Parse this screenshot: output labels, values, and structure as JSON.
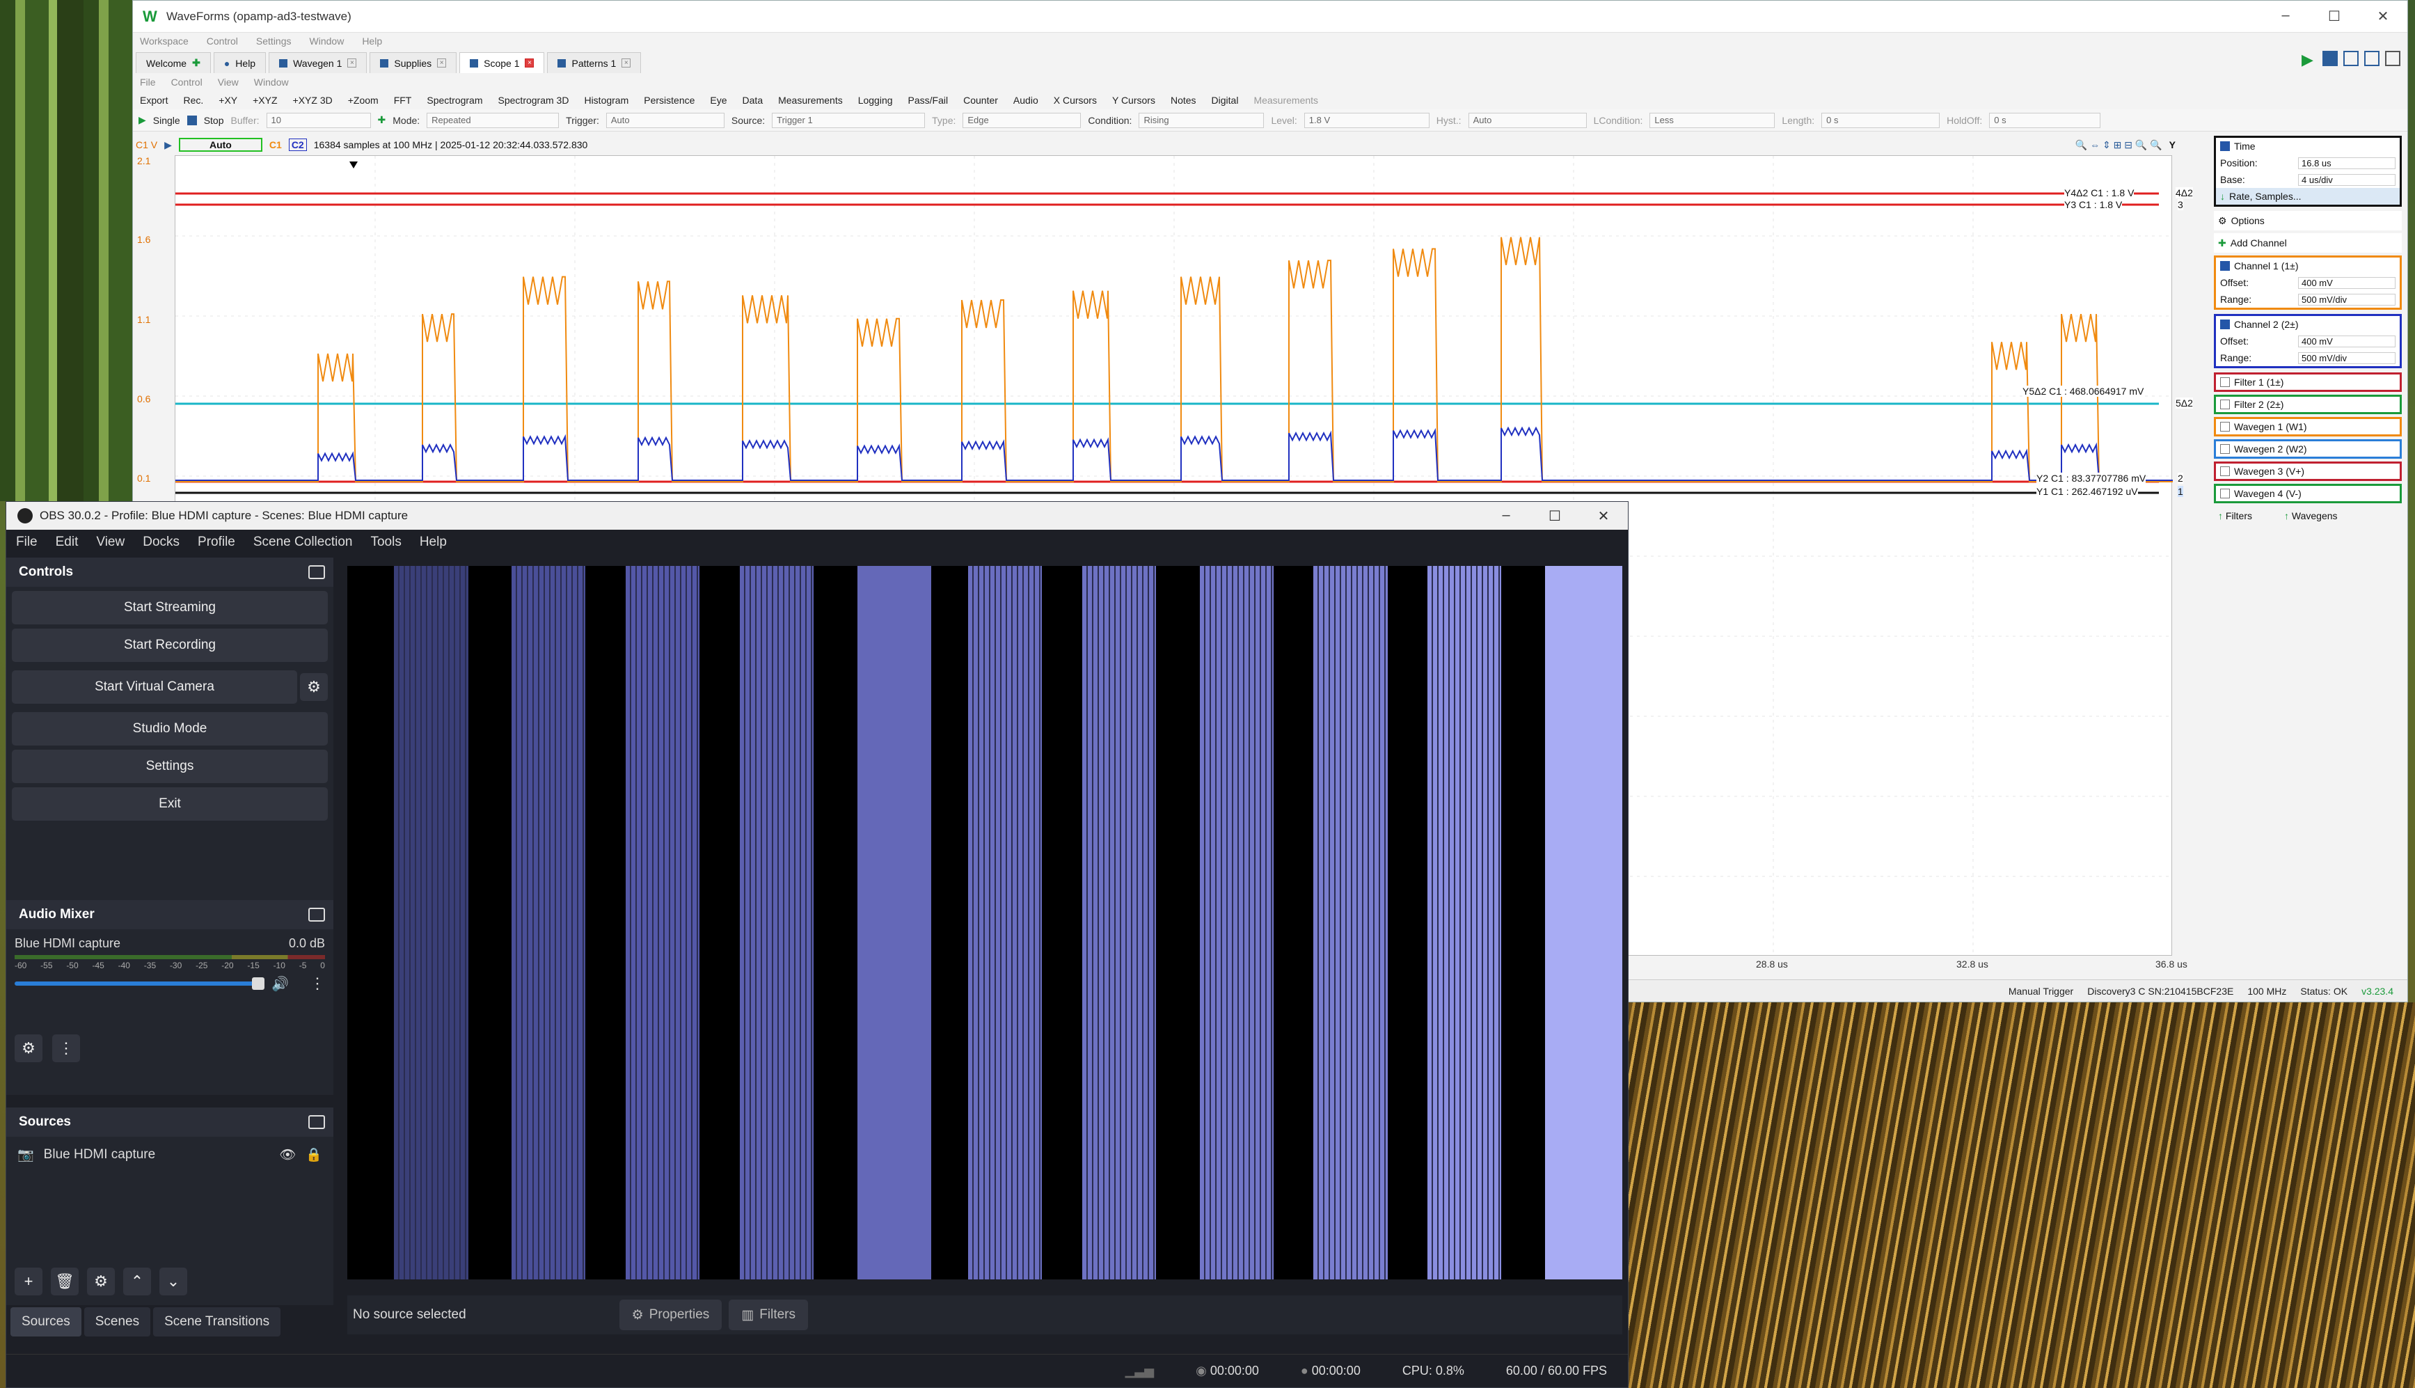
{
  "waveforms": {
    "title": "WaveForms (opamp-ad3-testwave)",
    "faint_menu": [
      "Workspace",
      "Control",
      "Settings",
      "Window",
      "Help"
    ],
    "tabs": [
      {
        "label": "Welcome",
        "close": "+"
      },
      {
        "label": "Help",
        "close": ""
      },
      {
        "label": "Wavegen 1",
        "close": "x"
      },
      {
        "label": "Supplies",
        "close": "x"
      },
      {
        "label": "Scope 1",
        "close": "x"
      },
      {
        "label": "Patterns 1",
        "close": "x"
      }
    ],
    "submenu": [
      "File",
      "Control",
      "View",
      "Window"
    ],
    "toolbar": [
      "Export",
      "Rec.",
      "+XY",
      "+XYZ",
      "+XYZ 3D",
      "+Zoom",
      "FFT",
      "Spectrogram",
      "Spectrogram 3D",
      "Histogram",
      "Persistence",
      "Eye",
      "Data",
      "Measurements",
      "Logging",
      "Pass/Fail",
      "Counter",
      "Audio",
      "X Cursors",
      "Y Cursors",
      "Notes",
      "Digital",
      "Measurements"
    ],
    "controls": {
      "single": "Single",
      "stop": "Stop",
      "buffer_label": "Buffer:",
      "buffer_value": "10",
      "mode_label": "Mode:",
      "mode_value": "Repeated",
      "trigger_label": "Trigger:",
      "trigger_value": "Auto",
      "source_label": "Source:",
      "source_value": "Trigger 1",
      "type_label": "Type:",
      "type_value": "Edge",
      "condition_label": "Condition:",
      "condition_value": "Rising",
      "level_label": "Level:",
      "level_value": "1.8 V",
      "hyst_label": "Hyst.:",
      "hyst_value": "Auto",
      "lcondition_label": "LCondition:",
      "lcondition_value": "Less",
      "length_label": "Length:",
      "length_value": "0 s",
      "holdoff_label": "HoldOff:",
      "holdoff_value": "0 s"
    },
    "scope_header": {
      "unit": "C1 V",
      "auto": "Auto",
      "c1": "C1",
      "c2": "C2",
      "info": "16384 samples at 100 MHz  | 2025-01-12 20:32:44.033.572.830",
      "y_button": "Y"
    },
    "y_labels": [
      "2.1",
      "1.6",
      "1.1",
      "0.6",
      "0.1"
    ],
    "cursor_labels": {
      "y4": "Y4Δ2 C1 : 1.8 V",
      "y3": "Y3 C1 : 1.8 V",
      "y5": "Y5Δ2 C1 : 468.0664917 mV",
      "y2": "Y2 C1 : 83.37707786 mV",
      "y1": "Y1 C1 : 262.467192 uV",
      "tag_4d2": "4Δ2",
      "tag_3": "3",
      "tag_5d2": "5Δ2",
      "tag_2": "2",
      "tag_1": "1"
    },
    "x_ticks": [
      "28.8 us",
      "32.8 us",
      "36.8 us"
    ],
    "right_panel": {
      "time_label": "Time",
      "position_label": "Position:",
      "position_value": "16.8 us",
      "base_label": "Base:",
      "base_value": "4 us/div",
      "rate_button": "Rate, Samples...",
      "options": "Options",
      "add_channel": "Add Channel",
      "ch1_label": "Channel 1 (1±)",
      "ch1_offset_label": "Offset:",
      "ch1_offset": "400 mV",
      "ch1_range_label": "Range:",
      "ch1_range": "500 mV/div",
      "ch2_label": "Channel 2 (2±)",
      "ch2_offset_label": "Offset:",
      "ch2_offset": "400 mV",
      "ch2_range_label": "Range:",
      "ch2_range": "500 mV/div",
      "items": [
        "Filter 1 (1±)",
        "Filter 2 (2±)",
        "Wavegen 1 (W1)",
        "Wavegen 2 (W2)",
        "Wavegen 3 (V+)",
        "Wavegen 4 (V-)"
      ],
      "filters_btn": "Filters",
      "wavegens_btn": "Wavegens"
    },
    "status": {
      "manual_trigger": "Manual Trigger",
      "device": "Discovery3 C SN:210415BCF23E",
      "rate": "100 MHz",
      "status": "Status: OK",
      "version": "v3.23.4"
    },
    "colors": {
      "ch1": "#f08a10",
      "ch2": "#2030c0",
      "cursor_red": "#e02020",
      "cursor_cyan": "#19b6c8"
    }
  },
  "obs": {
    "title": "OBS 30.0.2 - Profile: Blue HDMI capture - Scenes: Blue HDMI capture",
    "menu": [
      "File",
      "Edit",
      "View",
      "Docks",
      "Profile",
      "Scene Collection",
      "Tools",
      "Help"
    ],
    "controls_title": "Controls",
    "start_streaming": "Start Streaming",
    "start_recording": "Start Recording",
    "start_virtual_camera": "Start Virtual Camera",
    "studio_mode": "Studio Mode",
    "settings": "Settings",
    "exit": "Exit",
    "audio_mixer_title": "Audio Mixer",
    "audio_source": "Blue HDMI capture",
    "audio_db": "0.0 dB",
    "meter_ticks": [
      "-60",
      "-55",
      "-50",
      "-45",
      "-40",
      "-35",
      "-30",
      "-25",
      "-20",
      "-15",
      "-10",
      "-5",
      "0"
    ],
    "sources_title": "Sources",
    "source_item": "Blue HDMI capture",
    "tabs": [
      "Sources",
      "Scenes",
      "Scene Transitions"
    ],
    "no_source": "No source selected",
    "properties": "Properties",
    "filters": "Filters",
    "status": {
      "stream_time": "00:00:00",
      "rec_time": "00:00:00",
      "cpu": "CPU: 0.8%",
      "fps": "60.00 / 60.00 FPS"
    }
  }
}
